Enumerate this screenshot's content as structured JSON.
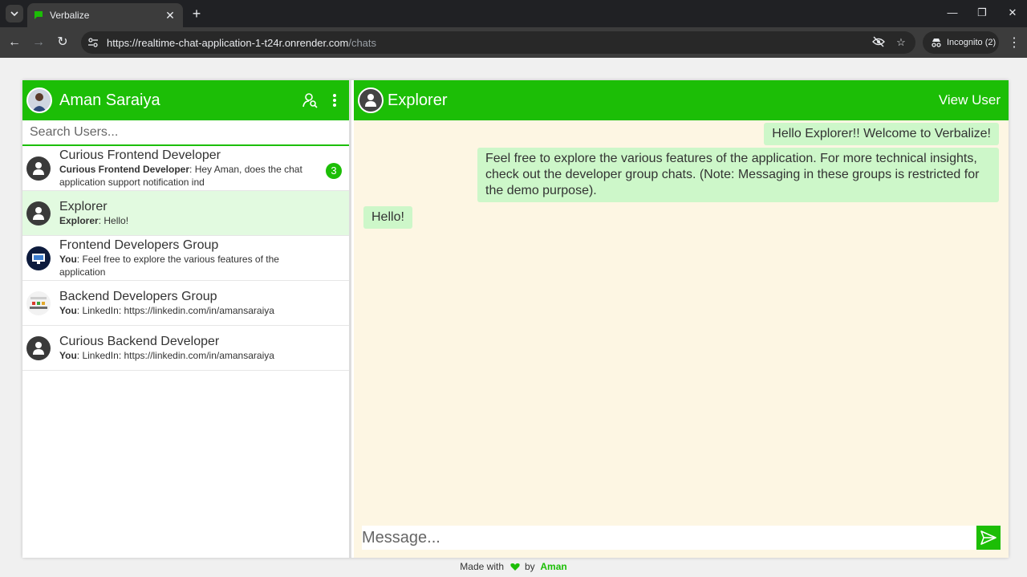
{
  "browser": {
    "tab_title": "Verbalize",
    "url_host": "https://realtime-chat-application-1-t24r.onrender.com",
    "url_path": "/chats",
    "incognito_label": "Incognito (2)",
    "icons": {
      "tab_list": "chevron-down-icon",
      "favicon": "chat-bubble-icon",
      "close_tab": "close-icon",
      "new_tab": "plus-icon",
      "back": "arrow-left-icon",
      "forward": "arrow-right-icon",
      "reload": "reload-icon",
      "site_info": "tune-icon",
      "eye_off": "eye-off-icon",
      "star": "star-icon",
      "incognito": "incognito-icon",
      "menu": "kebab-icon"
    }
  },
  "sidebar": {
    "user_name": "Aman Saraiya",
    "search_placeholder": "Search Users...",
    "icons": {
      "add_user": "user-search-icon",
      "menu": "kebab-icon"
    },
    "chats": [
      {
        "name": "Curious Frontend Developer",
        "preview_sender": "Curious Frontend Developer",
        "preview_text": ": Hey Aman, does the chat application support notification ind",
        "unread": "3",
        "avatar": "default-user-icon",
        "active": false
      },
      {
        "name": "Explorer",
        "preview_sender": "Explorer",
        "preview_text": ": Hello!",
        "avatar": "default-user-icon",
        "active": true
      },
      {
        "name": "Frontend Developers Group",
        "preview_sender": "You",
        "preview_text": ": Feel free to explore the various features of the application",
        "avatar": "monitor-group-icon",
        "active": false
      },
      {
        "name": "Backend Developers Group",
        "preview_sender": "You",
        "preview_text": ": LinkedIn: https://linkedin.com/in/amansaraiya",
        "avatar": "node-group-icon",
        "active": false
      },
      {
        "name": "Curious Backend Developer",
        "preview_sender": "You",
        "preview_text": ": LinkedIn: https://linkedin.com/in/amansaraiya",
        "avatar": "default-user-icon",
        "active": false
      }
    ]
  },
  "conversation": {
    "peer_name": "Explorer",
    "view_user_label": "View User",
    "messages": [
      {
        "text": "Hello Explorer!! Welcome to Verbalize!",
        "from": "me"
      },
      {
        "text": "Feel free to explore the various features of the application. For more technical insights, check out the developer group chats. (Note: Messaging in these groups is restricted for the demo purpose).",
        "from": "me"
      },
      {
        "text": "Hello!",
        "from": "peer"
      }
    ],
    "composer_placeholder": "Message...",
    "send_icon": "send-icon"
  },
  "footer": {
    "made_with": "Made with",
    "by": "by",
    "author": "Aman",
    "heart_icon": "heart-icon"
  },
  "colors": {
    "brand_green": "#1cbe06",
    "bubble": "#cdf7c9",
    "chat_bg": "#fdf6e3",
    "active_item": "#e2fae0"
  }
}
